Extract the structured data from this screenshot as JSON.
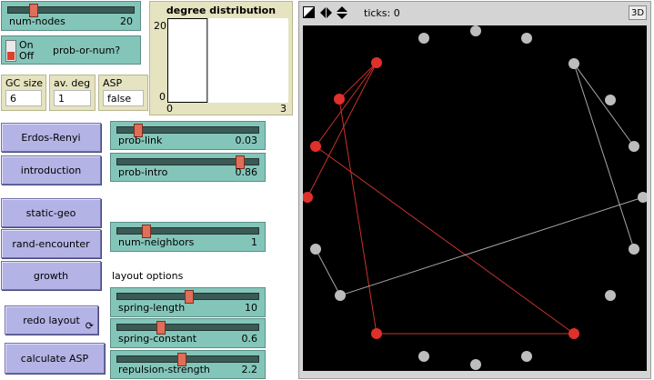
{
  "sliders": {
    "num_nodes": {
      "label": "num-nodes",
      "value": "20",
      "fraction": 0.26
    },
    "prob_link": {
      "label": "prob-link",
      "value": "0.03",
      "fraction": 0.03
    },
    "prob_intro": {
      "label": "prob-intro",
      "value": "0.86",
      "fraction": 0.86
    },
    "num_neighbors": {
      "label": "num-neighbors",
      "value": "1",
      "fraction": 0.05
    },
    "spring_length": {
      "label": "spring-length",
      "value": "10",
      "fraction": 0.5
    },
    "spring_constant": {
      "label": "spring-constant",
      "value": "0.6",
      "fraction": 0.3
    },
    "repulsion_strength": {
      "label": "repulsion-strength",
      "value": "2.2",
      "fraction": 0.44
    }
  },
  "switch": {
    "on_label": "On",
    "off_label": "Off",
    "label": "prob-or-num?"
  },
  "plot": {
    "title": "degree distribution",
    "y_max_label": "20",
    "y_min_label": "0",
    "x_min_label": "0",
    "x_max_label": "3",
    "chart_data": {
      "type": "bar",
      "title": "degree distribution",
      "xlim": [
        0,
        3
      ],
      "ylim": [
        0,
        20
      ],
      "bars": [
        {
          "x_start": 0,
          "x_end": 1,
          "value": 20
        }
      ]
    }
  },
  "monitors": {
    "gc_size": {
      "label": "GC size",
      "value": "6"
    },
    "av_deg": {
      "label": "av. deg",
      "value": "1"
    },
    "asp": {
      "label": "ASP",
      "value": "false"
    }
  },
  "buttons": {
    "erdos_renyi": "Erdos-Renyi",
    "introduction": "introduction",
    "static_geo": "static-geo",
    "rand_encounter": "rand-encounter",
    "growth": "growth",
    "redo_layout": "redo layout",
    "calculate_asp": "calculate ASP"
  },
  "text": {
    "layout_options": "layout options"
  },
  "view": {
    "ticks_label": "ticks: 0",
    "three_d_label": "3D",
    "colors": {
      "background": "#000000",
      "red_node": "#e0302a",
      "gray_node": "#bdbdbd",
      "red_link": "#c8322b",
      "gray_link": "#a8a8a8"
    }
  }
}
